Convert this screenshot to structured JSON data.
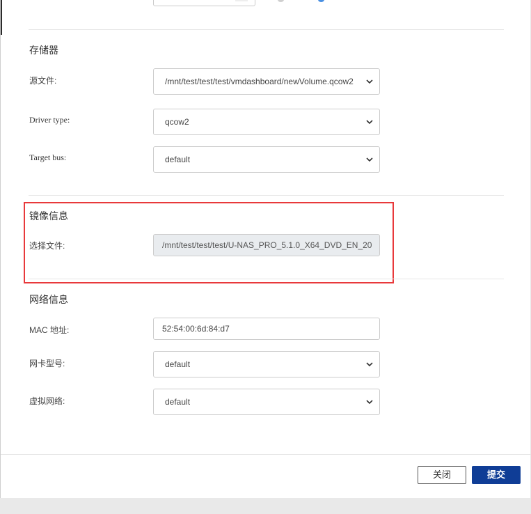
{
  "storage": {
    "title": "存储器",
    "source_file_label": "源文件:",
    "source_file_value": "/mnt/test/test/test/vmdashboard/newVolume.qcow2",
    "driver_type_label": "Driver type:",
    "driver_type_value": "qcow2",
    "target_bus_label": "Target bus:",
    "target_bus_value": "default"
  },
  "image_info": {
    "title": "镜像信息",
    "select_file_label": "选择文件:",
    "select_file_value": "/mnt/test/test/test/U-NAS_PRO_5.1.0_X64_DVD_EN_20"
  },
  "network_info": {
    "title": "网络信息",
    "mac_label": "MAC 地址:",
    "mac_value": "52:54:00:6d:84:d7",
    "nic_model_label": "网卡型号:",
    "nic_model_value": "default",
    "virtual_network_label": "虚拟网络:",
    "virtual_network_value": "default"
  },
  "footer": {
    "close_label": "关闭",
    "submit_label": "提交"
  },
  "colors": {
    "highlight": "#e8393b",
    "primary_button": "#0f3d96"
  },
  "icons": {
    "select_arrow": "chevron-down-icon"
  }
}
